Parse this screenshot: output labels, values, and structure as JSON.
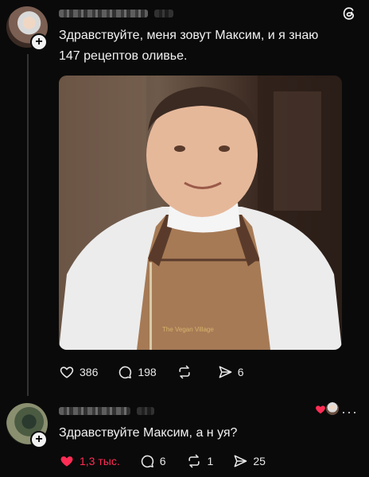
{
  "post": {
    "text": "Здравствуйте, меня зовут Максим, и я знаю 147 рецептов оливье.",
    "likes": "386",
    "comments": "198",
    "shares": "6"
  },
  "reply": {
    "text": "Здравствуйте Максим, а н  уя?",
    "likes": "1,3 тыс.",
    "comments": "6",
    "reposts": "1",
    "shares": "25"
  },
  "icons": {
    "app_logo": "threads-icon",
    "like": "heart-icon",
    "comment": "comment-icon",
    "repost": "repost-icon",
    "share": "send-icon"
  },
  "colors": {
    "background": "#0a0a0a",
    "liked": "#ff2d55"
  }
}
